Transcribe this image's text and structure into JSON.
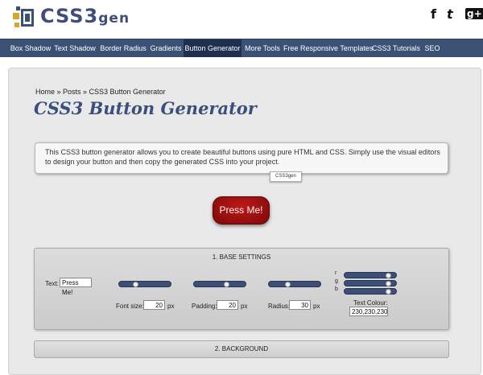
{
  "header": {
    "logo": {
      "text_main": "CSS3",
      "text_suffix": "gen"
    },
    "social": [
      {
        "name": "facebook-icon",
        "glyph": "f"
      },
      {
        "name": "twitter-icon",
        "glyph": "t"
      },
      {
        "name": "google-plus-icon",
        "glyph": "g+"
      }
    ]
  },
  "nav": {
    "items": [
      {
        "label": "Box Shadow"
      },
      {
        "label": "Text Shadow"
      },
      {
        "label": "Border Radius"
      },
      {
        "label": "Gradients"
      },
      {
        "label": "Button Generator",
        "active": true
      },
      {
        "label": "More Tools"
      },
      {
        "label": "Free Responsive Templates"
      },
      {
        "label": "CSS3 Tutorials"
      },
      {
        "label": "SEO"
      }
    ]
  },
  "breadcrumb": "Home » Posts » CSS3 Button Generator",
  "page_title": "CSS3 Button Generator",
  "intro": "This CSS3 button generator allows you to create beautiful buttons using pure HTML and CSS. Simply use the visual editors to design your button and then copy the generated CSS into your project.",
  "tooltip": "CSS3gen",
  "preview_button": "Press Me!",
  "base_settings": {
    "title": "1. BASE SETTINGS",
    "text_label": "Text:",
    "text_value": "Press Me!",
    "font_size": {
      "label": "Font size:",
      "value": "20",
      "unit": "px",
      "slider_value": 0.3
    },
    "padding": {
      "label": "Padding:",
      "value": "20",
      "unit": "px",
      "slider_value": 0.65
    },
    "radius": {
      "label": "Radius:",
      "value": "30",
      "unit": "px",
      "slider_value": 0.35
    },
    "text_colour": {
      "label": "Text Colour:",
      "value": "230,230,230",
      "channels": [
        {
          "name": "r",
          "slider_value": 0.9
        },
        {
          "name": "g",
          "slider_value": 0.9
        },
        {
          "name": "b",
          "slider_value": 0.9
        }
      ]
    }
  },
  "background_section": {
    "title": "2. BACKGROUND"
  },
  "colors": {
    "nav_bg": "#3b5276",
    "nav_active": "#1e2f4f",
    "title": "#3a4f7c",
    "button_red": "#b01515"
  }
}
